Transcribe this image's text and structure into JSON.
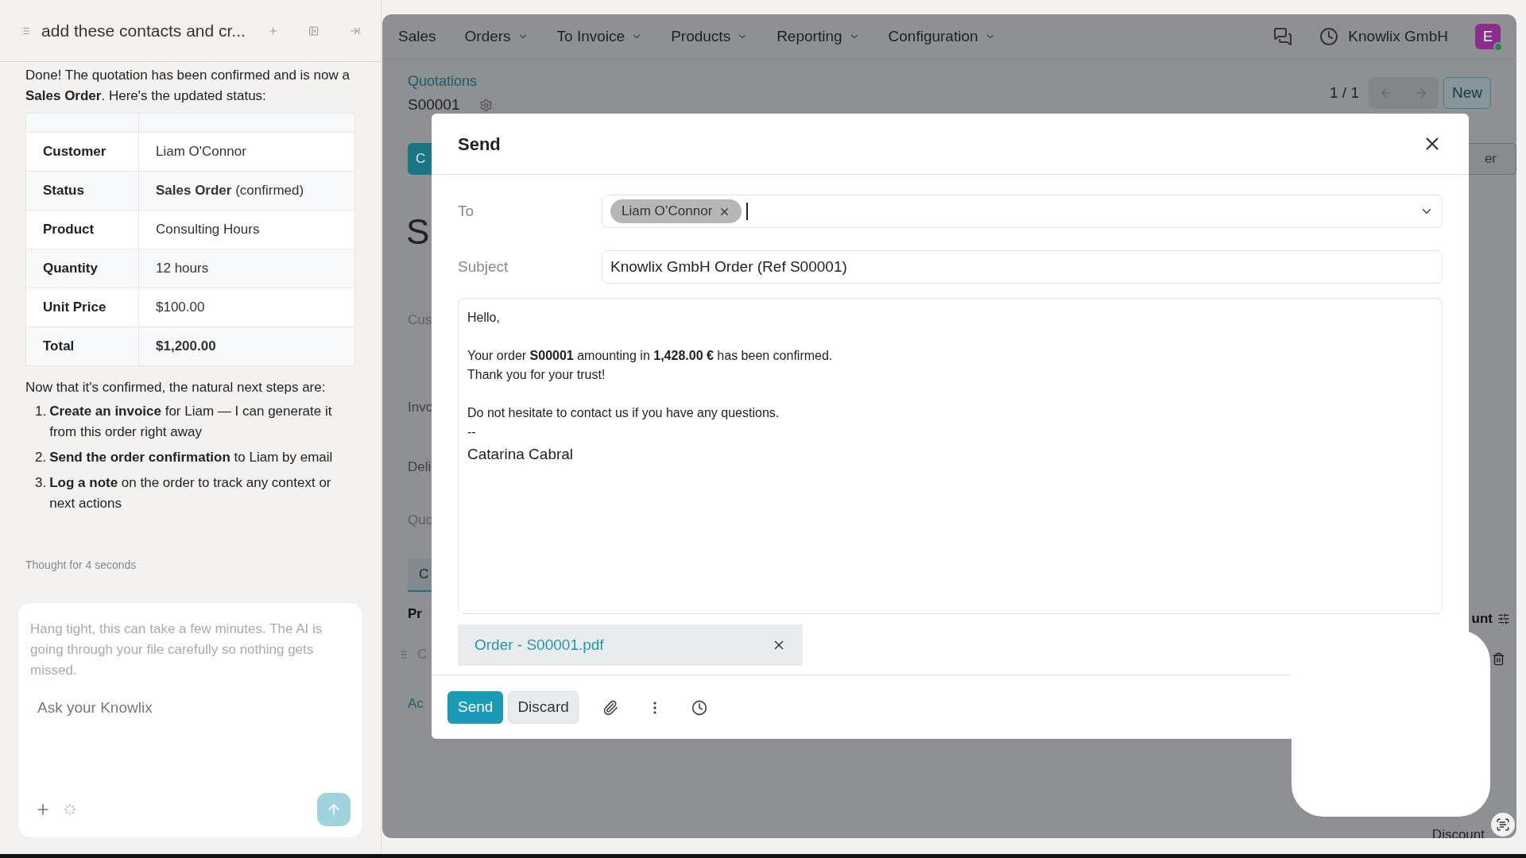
{
  "assistant": {
    "title": "add these contacts and cr...",
    "message": "Done! The quotation has been confirmed and is now a **Sales Order**. Here's the updated status:",
    "status_table": [
      {
        "label": "Customer",
        "value": "Liam O'Connor"
      },
      {
        "label": "Status",
        "value": "**Sales Order** (confirmed)"
      },
      {
        "label": "Product",
        "value": "Consulting Hours"
      },
      {
        "label": "Quantity",
        "value": "12 hours"
      },
      {
        "label": "Unit Price",
        "value": "$100.00"
      },
      {
        "label": "Total",
        "value": "**$1,200.00**"
      }
    ],
    "intro": "Now that it's confirmed, the natural next steps are:",
    "steps": [
      {
        "number": "1.",
        "text": "**Create an invoice** for Liam — I can generate it from this order right away"
      },
      {
        "number": "2.",
        "text": "**Send the order confirmation** to Liam by email"
      },
      {
        "number": "3.",
        "text": "**Log a note** on the order to track any context or next actions"
      }
    ],
    "thought": "Thought for 4 seconds",
    "composer": {
      "notice": "Hang tight, this can take a few minutes. The AI is going through your file carefully so nothing gets missed.",
      "placeholder": "Ask your Knowlix"
    }
  },
  "app": {
    "menu": [
      {
        "label": "Sales",
        "dropdown": false
      },
      {
        "label": "Orders",
        "dropdown": true
      },
      {
        "label": "To Invoice",
        "dropdown": true
      },
      {
        "label": "Products",
        "dropdown": true
      },
      {
        "label": "Reporting",
        "dropdown": true
      },
      {
        "label": "Configuration",
        "dropdown": true
      }
    ],
    "company": "Knowlix GmbH",
    "avatar": "E",
    "breadcrumb": "Quotations",
    "record": "S00001",
    "pager": "1 / 1",
    "new_button": "New",
    "form_fragments": {
      "button_left": "C",
      "button_right": "er",
      "title": "S",
      "fields": [
        "Cus",
        "Invo",
        "Deli",
        "Quo"
      ],
      "tab": "C",
      "column_left": "Pr",
      "column_right": "unt",
      "line": "C",
      "add_link": "Ac",
      "discount": "Discount"
    }
  },
  "dialog": {
    "title": "Send",
    "to_label": "To",
    "recipients": [
      "Liam O’Connor"
    ],
    "subject_label": "Subject",
    "subject": "Knowlix GmbH Order (Ref S00001)",
    "body": [
      {
        "lines": [
          "Hello,"
        ]
      },
      {
        "lines": [
          "Your order **S00001** amounting in **1,428.00 €** has been confirmed.",
          "Thank you for your trust!"
        ]
      },
      {
        "lines": [
          "Do not hesitate to contact us if you have any questions.",
          "--"
        ]
      },
      {
        "lines": [
          "Catarina Cabral"
        ],
        "kind": "signature"
      }
    ],
    "attachments": [
      "Order - S00001.pdf"
    ],
    "buttons": [
      {
        "label": "Send",
        "kind": "primary"
      },
      {
        "label": "Discard",
        "kind": "secondary"
      }
    ]
  }
}
